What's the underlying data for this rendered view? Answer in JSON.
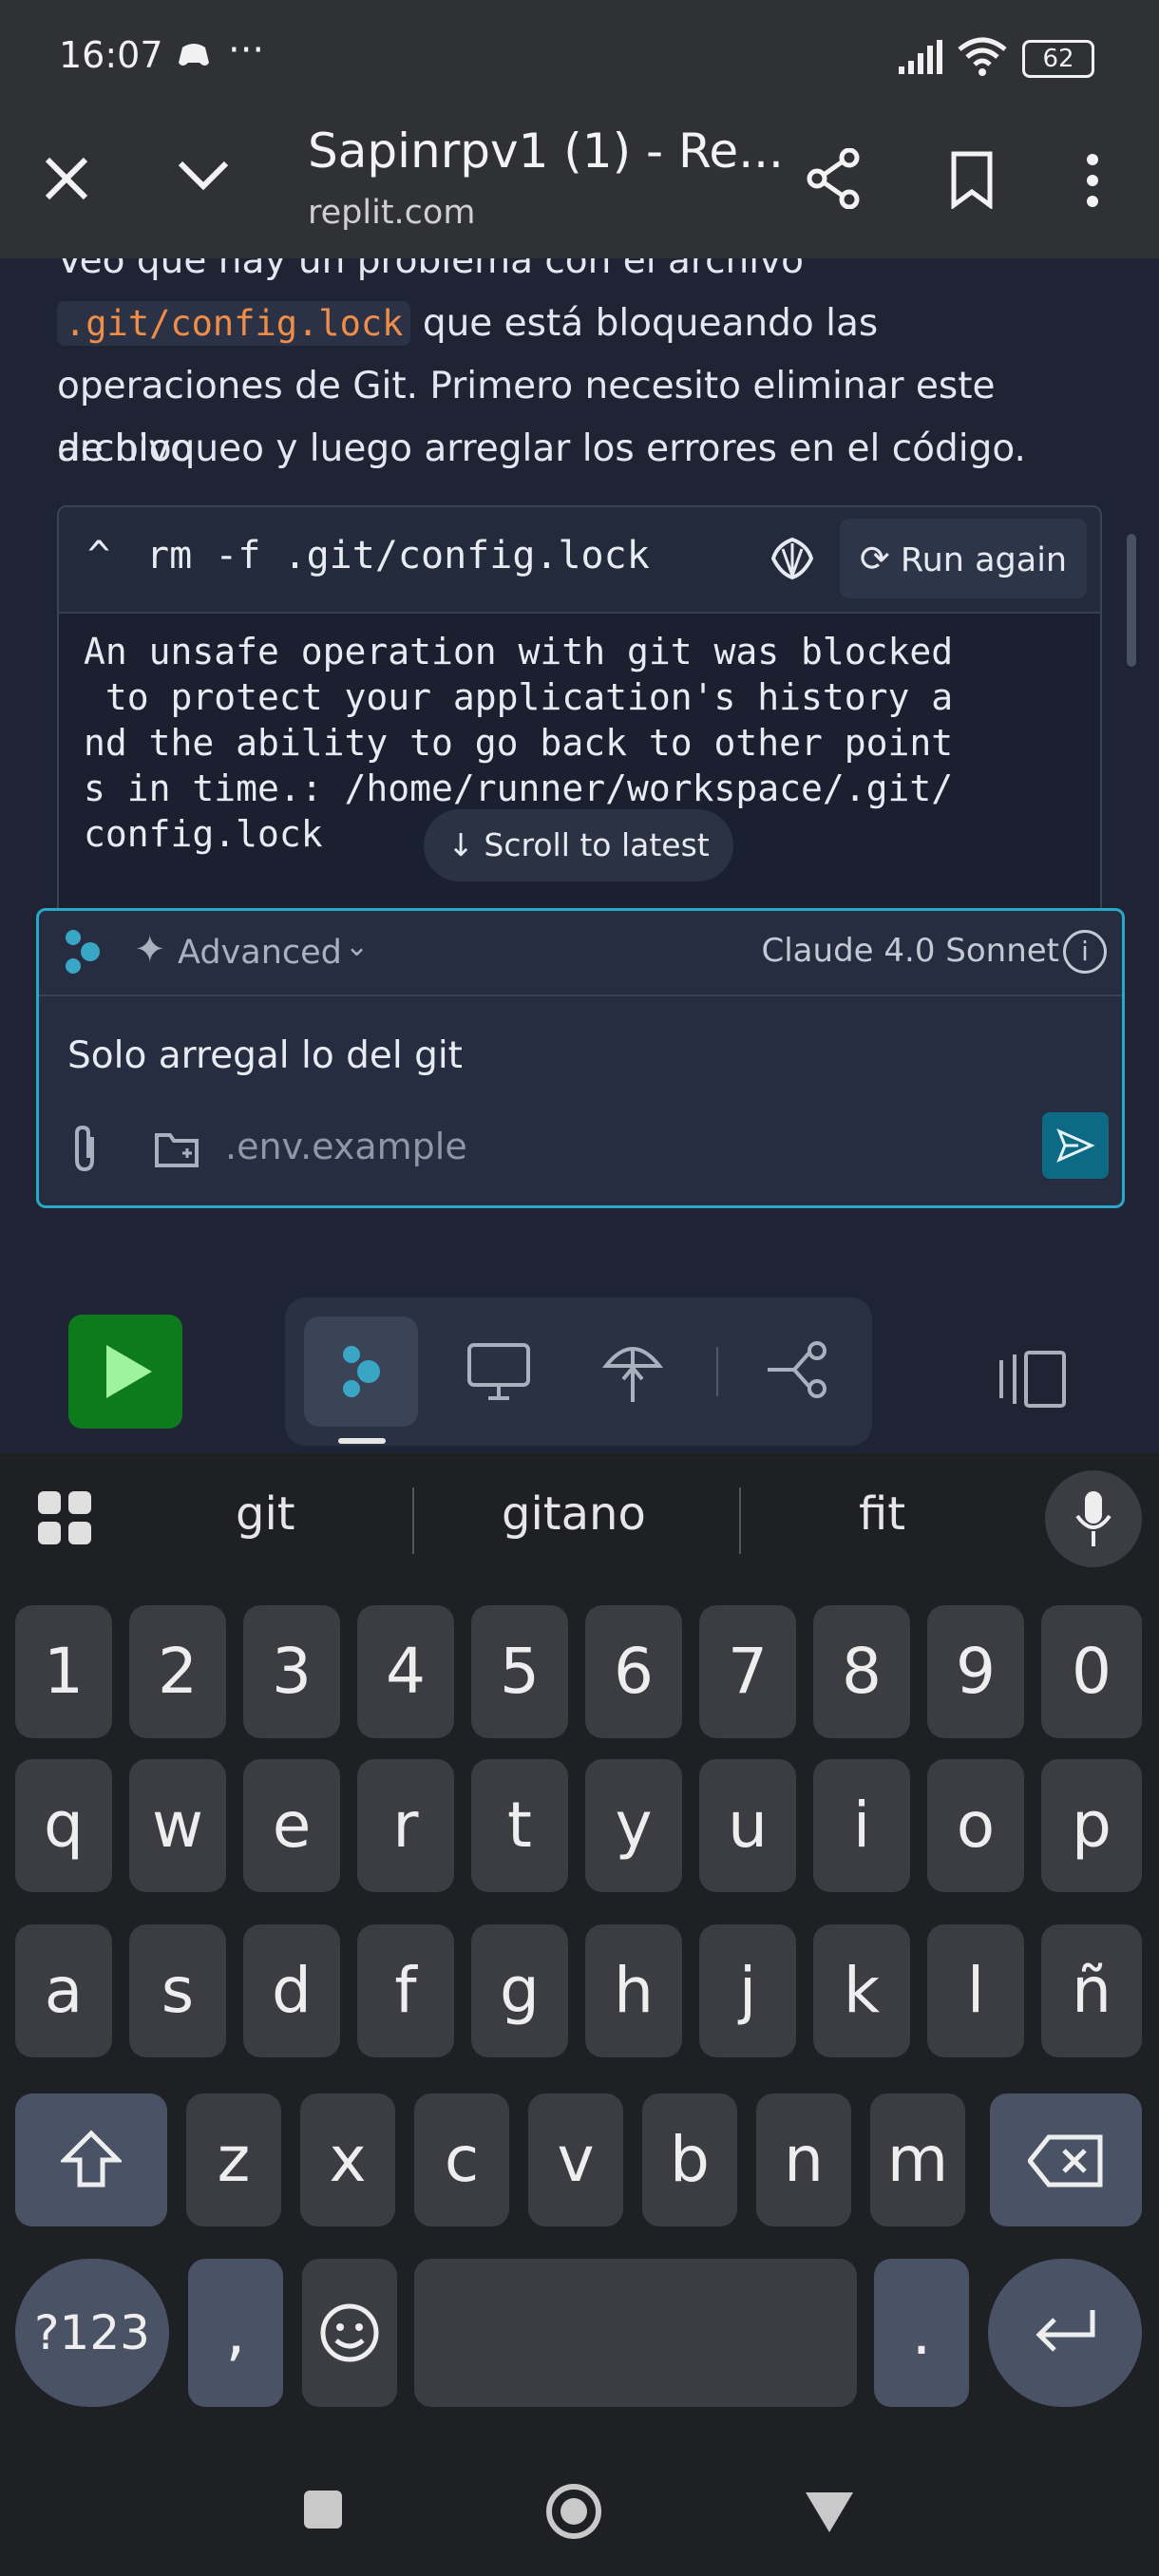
{
  "status": {
    "time": "16:07",
    "battery": "62"
  },
  "browser": {
    "title": "Sapinrpv1 (1) - Re...",
    "host": "replit.com"
  },
  "chat": {
    "partial_line": "Veo que hay un problema con el archivo",
    "inline_code": ".git/config.lock",
    "line2_rest": " que está bloqueando las",
    "line3": "operaciones de Git. Primero necesito eliminar este archivo",
    "line4": "de bloqueo y luego arreglar los errores en el código."
  },
  "command": {
    "caret": "^",
    "text": "rm -f .git/config.lock",
    "run_again": "Run again",
    "output": "An unsafe operation with git was blocked\n to protect your application's history a\nnd the ability to go back to other point\ns in time.: /home/runner/workspace/.git/\nconfig.lock",
    "scroll_to_latest": "Scroll to latest"
  },
  "composer": {
    "mode": "Advanced",
    "model": "Claude 4.0 Sonnet",
    "message": "Solo arregal lo del git",
    "attached_file": ".env.example"
  },
  "keyboard": {
    "suggestions": [
      "git",
      "gitano",
      "fit"
    ],
    "row_numbers": [
      "1",
      "2",
      "3",
      "4",
      "5",
      "6",
      "7",
      "8",
      "9",
      "0"
    ],
    "row_q": [
      "q",
      "w",
      "e",
      "r",
      "t",
      "y",
      "u",
      "i",
      "o",
      "p"
    ],
    "row_a": [
      "a",
      "s",
      "d",
      "f",
      "g",
      "h",
      "j",
      "k",
      "l",
      "ñ"
    ],
    "row_z": [
      "z",
      "x",
      "c",
      "v",
      "b",
      "n",
      "m"
    ],
    "symbols": "?123",
    "comma": ",",
    "period": "."
  },
  "colors": {
    "accent": "#2aa8c8",
    "run": "#0d7a1c",
    "send": "#0d6a84",
    "code": "#f08d49"
  }
}
